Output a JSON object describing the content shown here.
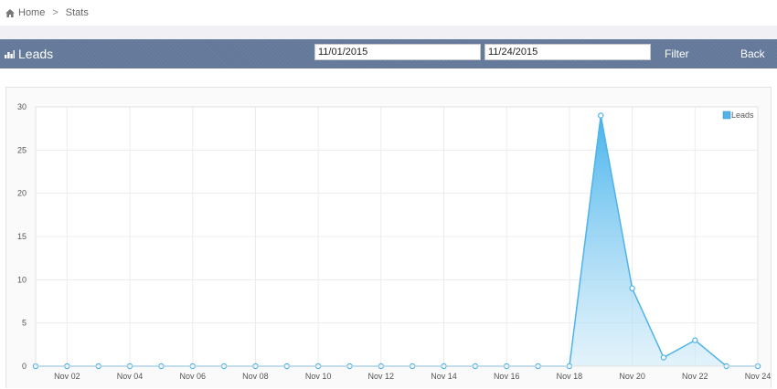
{
  "breadcrumb": {
    "home_label": "Home",
    "separator": ">",
    "current": "Stats"
  },
  "header": {
    "title": "Leads",
    "icon": "bar-chart-icon",
    "start_date": "11/01/2015",
    "end_date": "11/24/2015",
    "filter_label": "Filter",
    "back_label": "Back",
    "color": "#64799a"
  },
  "chart_data": {
    "type": "area",
    "x": [
      "Nov 01",
      "Nov 02",
      "Nov 03",
      "Nov 04",
      "Nov 05",
      "Nov 06",
      "Nov 07",
      "Nov 08",
      "Nov 09",
      "Nov 10",
      "Nov 11",
      "Nov 12",
      "Nov 13",
      "Nov 14",
      "Nov 15",
      "Nov 16",
      "Nov 17",
      "Nov 18",
      "Nov 19",
      "Nov 20",
      "Nov 21",
      "Nov 22",
      "Nov 23",
      "Nov 24"
    ],
    "x_tick_labels": [
      "Nov 02",
      "Nov 04",
      "Nov 06",
      "Nov 08",
      "Nov 10",
      "Nov 12",
      "Nov 14",
      "Nov 16",
      "Nov 18",
      "Nov 20",
      "Nov 22",
      "Nov 24"
    ],
    "series": [
      {
        "name": "Leads",
        "values": [
          0,
          0,
          0,
          0,
          0,
          0,
          0,
          0,
          0,
          0,
          0,
          0,
          0,
          0,
          0,
          0,
          0,
          0,
          29,
          9,
          1,
          3,
          0,
          0
        ],
        "color": "#4fb3e8"
      }
    ],
    "ylim": [
      0,
      30
    ],
    "yticks": [
      0,
      5,
      10,
      15,
      20,
      25,
      30
    ],
    "grid": true,
    "legend": "top-right"
  }
}
